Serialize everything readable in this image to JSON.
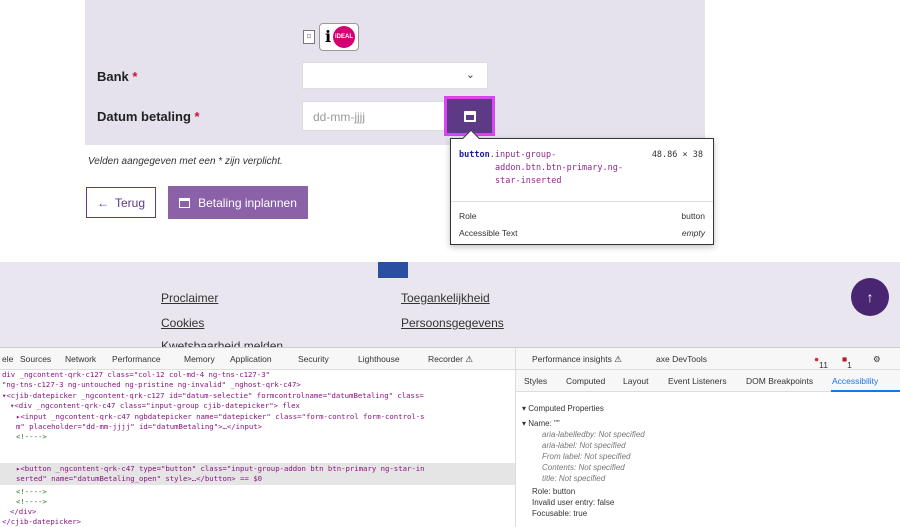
{
  "form": {
    "ideal_logo_text": "iDEAL",
    "bank_label": "Bank",
    "date_label": "Datum betaling",
    "required_mark": "*",
    "date_placeholder": "dd-mm-jjjj",
    "required_note": "Velden aangegeven met een * zijn verplicht.",
    "back_label": "Terug",
    "schedule_label": "Betaling inplannen"
  },
  "inspect_tooltip": {
    "element": "button",
    "classes_line1": ".input-group-",
    "classes_line2": "addon.btn.btn-primary.ng-",
    "classes_line3": "star-inserted",
    "dimensions": "48.86 × 38",
    "role_label": "Role",
    "role_value": "button",
    "accessible_text_label": "Accessible Text",
    "accessible_text_value": "empty"
  },
  "footer": {
    "links": [
      "Proclaimer",
      "Toegankelijkheid",
      "Cookies",
      "Persoonsgegevens",
      "Kwetsbaarheid melden"
    ]
  },
  "devtools": {
    "tabs": [
      "ele",
      "Sources",
      "Network",
      "Performance",
      "Memory",
      "Application",
      "Security",
      "Lighthouse",
      "Recorder ⚠"
    ],
    "tabs_right": [
      "Performance insights ⚠",
      "axe DevTools"
    ],
    "error_count": "11",
    "warning_count": "1",
    "subtabs": [
      "Styles",
      "Computed",
      "Layout",
      "Event Listeners",
      "DOM Breakpoints",
      "Accessibility"
    ],
    "dom_lines": [
      "div _ngcontent-qrk-c127 class=\"col-12 col-md-4 ng-tns-c127-3\"",
      "\"ng-tns-c127-3 ng-untouched ng-pristine ng-invalid\" _nghost-qrk-c47>",
      "▾<cjib-datepicker _ngcontent-qrk-c127 id=\"datum-selectie\" formcontrolname=\"datumBetaling\" class=",
      " ▾<div _ngcontent-qrk-c47 class=\"input-group cjib-datepicker\"> flex",
      "   ▸<input _ngcontent-qrk-c47 ngbdatepicker name=\"datepicker\" class=\"form-control form-control-s",
      "    m\" placeholder=\"dd-mm-jjjj\" id=\"datumBetaling\">…</input>",
      "    <!---->",
      "   ▸<button _ngcontent-qrk-c47 type=\"button\" class=\"input-group-addon btn btn-primary ng-star-in",
      "    serted\" name=\"datumBetaling_open\" style>…</button> == $0",
      "    <!---->",
      "    <!---->",
      "  </div>",
      " </cjib-datepicker>",
      " <!---->"
    ],
    "computed_properties_label": "Computed Properties",
    "name_label": "Name: \"\"",
    "aria_labelledby": "aria-labelledby: Not specified",
    "aria_label": "aria-label: Not specified",
    "from_label": "From label: Not specified",
    "contents": "Contents: Not specified",
    "title": "title: Not specified",
    "role_line": "Role: button",
    "invalid_line": "Invalid user entry: false",
    "focusable_line": "Focusable: true"
  },
  "colors": {
    "brand_purple": "#5e3a86",
    "highlight": "#d946ef",
    "ideal_pink": "#d50072"
  }
}
